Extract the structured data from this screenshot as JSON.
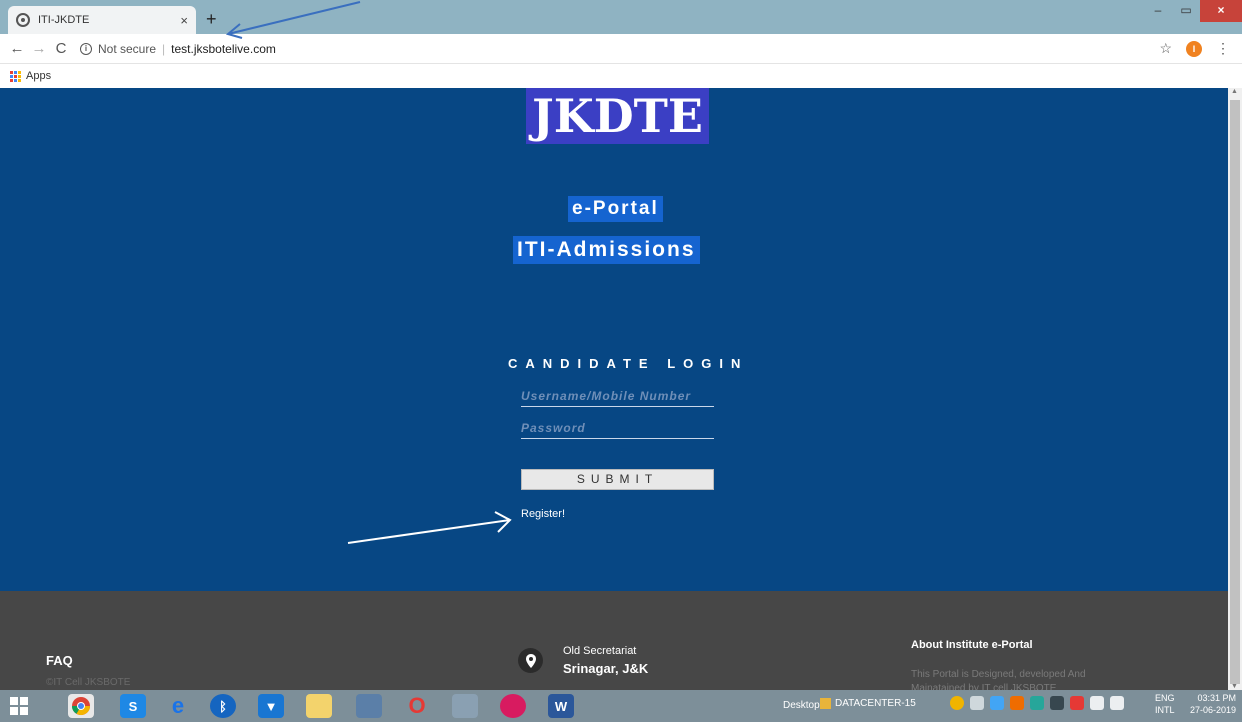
{
  "browser": {
    "tab_title": "ITI-JKDTE",
    "tab_close": "×",
    "new_tab": "+",
    "security_label": "Not secure",
    "url": "test.jksbotelive.com",
    "profile_initial": "I",
    "bookmarks": {
      "apps_label": "Apps"
    },
    "window_controls": {
      "minimize": "–",
      "maximize": "▭",
      "close": "×"
    }
  },
  "page": {
    "logo": "JKDTE",
    "heading1": "e-Portal",
    "heading2": "ITI-Admissions",
    "login": {
      "title": "CANDIDATE LOGIN",
      "username_placeholder": "Username/Mobile Number",
      "password_placeholder": "Password",
      "submit_label": "SUBMIT",
      "register_label": "Register!"
    },
    "colors": {
      "background": "#074784",
      "highlight": "#1564d0",
      "logo_bg": "#3b3fc4",
      "footer": "#474747"
    }
  },
  "footer": {
    "faq": "FAQ",
    "copyright": "©IT Cell JKSBOTE",
    "address_line1": "Old Secretariat",
    "address_line2": "Srinagar, J&K",
    "about_title": "About Institute e-Portal",
    "about_text": "This Portal is Designed, developed And Mainatained by IT cell JKSBOTE"
  },
  "taskbar": {
    "desktop_label": "Desktop",
    "window_label": "DATACENTER-15",
    "lang_line1": "ENG",
    "lang_line2": "INTL",
    "time": "03:31 PM",
    "date": "27-06-2019"
  }
}
